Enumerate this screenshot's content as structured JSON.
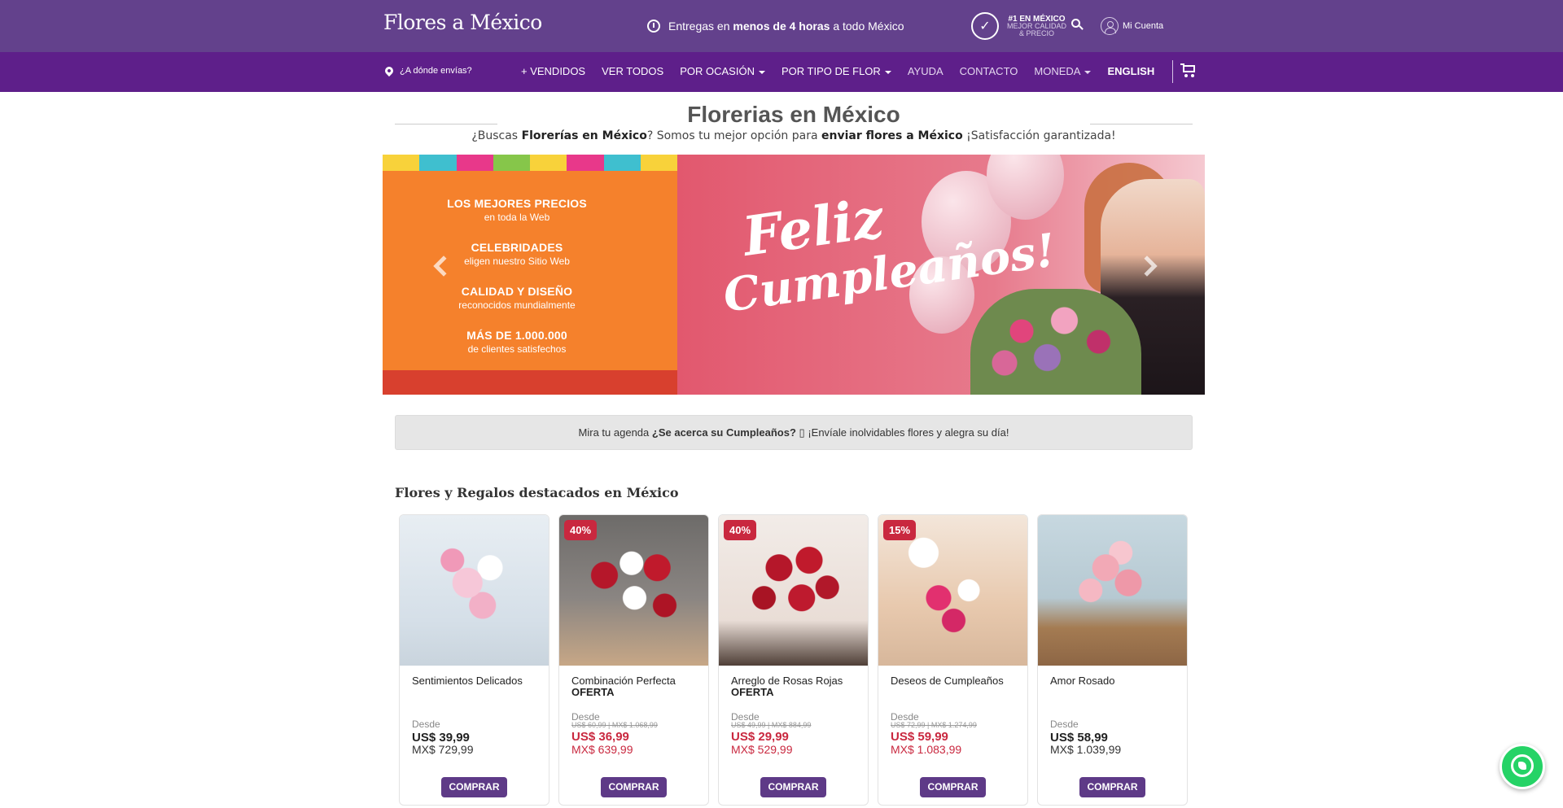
{
  "header": {
    "logo": "Flores a México",
    "delivery_prefix": "Entregas en",
    "delivery_bold": "menos de 4 horas",
    "delivery_suffix": "a todo México",
    "badge_line1": "#1 EN MÉXICO",
    "badge_line2": "MEJOR CALIDAD",
    "badge_line3": "& PRECIO",
    "account_label": "Mi Cuenta"
  },
  "nav": {
    "location_placeholder": "¿A dónde envías?",
    "items": [
      {
        "label": "+ VENDIDOS"
      },
      {
        "label": "VER TODOS"
      },
      {
        "label": "POR OCASIÓN"
      },
      {
        "label": "POR TIPO DE FLOR"
      },
      {
        "label": "AYUDA"
      },
      {
        "label": "CONTACTO"
      },
      {
        "label": "MONEDA"
      },
      {
        "label": "ENGLISH"
      }
    ]
  },
  "page": {
    "title": "Florerias en México",
    "subtitle_1": "¿Buscas",
    "subtitle_b1": "Florerías en México",
    "subtitle_2": "? Somos tu mejor opción para",
    "subtitle_b2": "enviar flores a México",
    "subtitle_3": "¡Satisfacción garantizada!"
  },
  "banner": {
    "promo": [
      {
        "title": "LOS MEJORES PRECIOS",
        "sub": "en toda la Web"
      },
      {
        "title": "CELEBRIDADES",
        "sub": "eligen nuestro Sitio Web"
      },
      {
        "title": "CALIDAD Y DISEÑO",
        "sub": "reconocidos mundialmente"
      },
      {
        "title": "MÁS DE 1.000.000",
        "sub": "de clientes satisfechos"
      }
    ],
    "headline_1": "Feliz",
    "headline_2": "Cumpleaños!"
  },
  "notice": {
    "prefix": "Mira tu agenda",
    "bold": "¿Se acerca su Cumpleaños?",
    "suffix": "¡Envíale inolvidables flores y alegra su día!"
  },
  "section_title": "Flores y Regalos destacados en México",
  "products": [
    {
      "name": "Sentimientos Delicados",
      "tag": "",
      "discount": "",
      "desde": "Desde",
      "was": "",
      "usd": "US$ 39,99",
      "mxn": "MX$ 729,99",
      "buy": "COMPRAR"
    },
    {
      "name": "Combinación Perfecta",
      "tag": "OFERTA",
      "discount": "40%",
      "desde": "Desde",
      "was": "US$ 60,99 | MX$ 1.068,99",
      "usd": "US$ 36,99",
      "mxn": "MX$ 639,99",
      "buy": "COMPRAR"
    },
    {
      "name": "Arreglo de Rosas Rojas",
      "tag": "OFERTA",
      "discount": "40%",
      "desde": "Desde",
      "was": "US$ 49,99 | MX$ 884,99",
      "usd": "US$ 29,99",
      "mxn": "MX$ 529,99",
      "buy": "COMPRAR"
    },
    {
      "name": "Deseos de Cumpleaños",
      "tag": "",
      "discount": "15%",
      "desde": "Desde",
      "was": "US$ 72,99 | MX$ 1.274,99",
      "usd": "US$ 59,99",
      "mxn": "MX$ 1.083,99",
      "buy": "COMPRAR"
    },
    {
      "name": "Amor Rosado",
      "tag": "",
      "discount": "",
      "desde": "Desde",
      "was": "",
      "usd": "US$ 58,99",
      "mxn": "MX$ 1.039,99",
      "buy": "COMPRAR"
    }
  ],
  "colors": {
    "topbar": "#63418c",
    "navbar": "#5e1f8a",
    "sale_red": "#c9283f",
    "button_purple": "#5e3a87",
    "whatsapp_green": "#25d366"
  }
}
